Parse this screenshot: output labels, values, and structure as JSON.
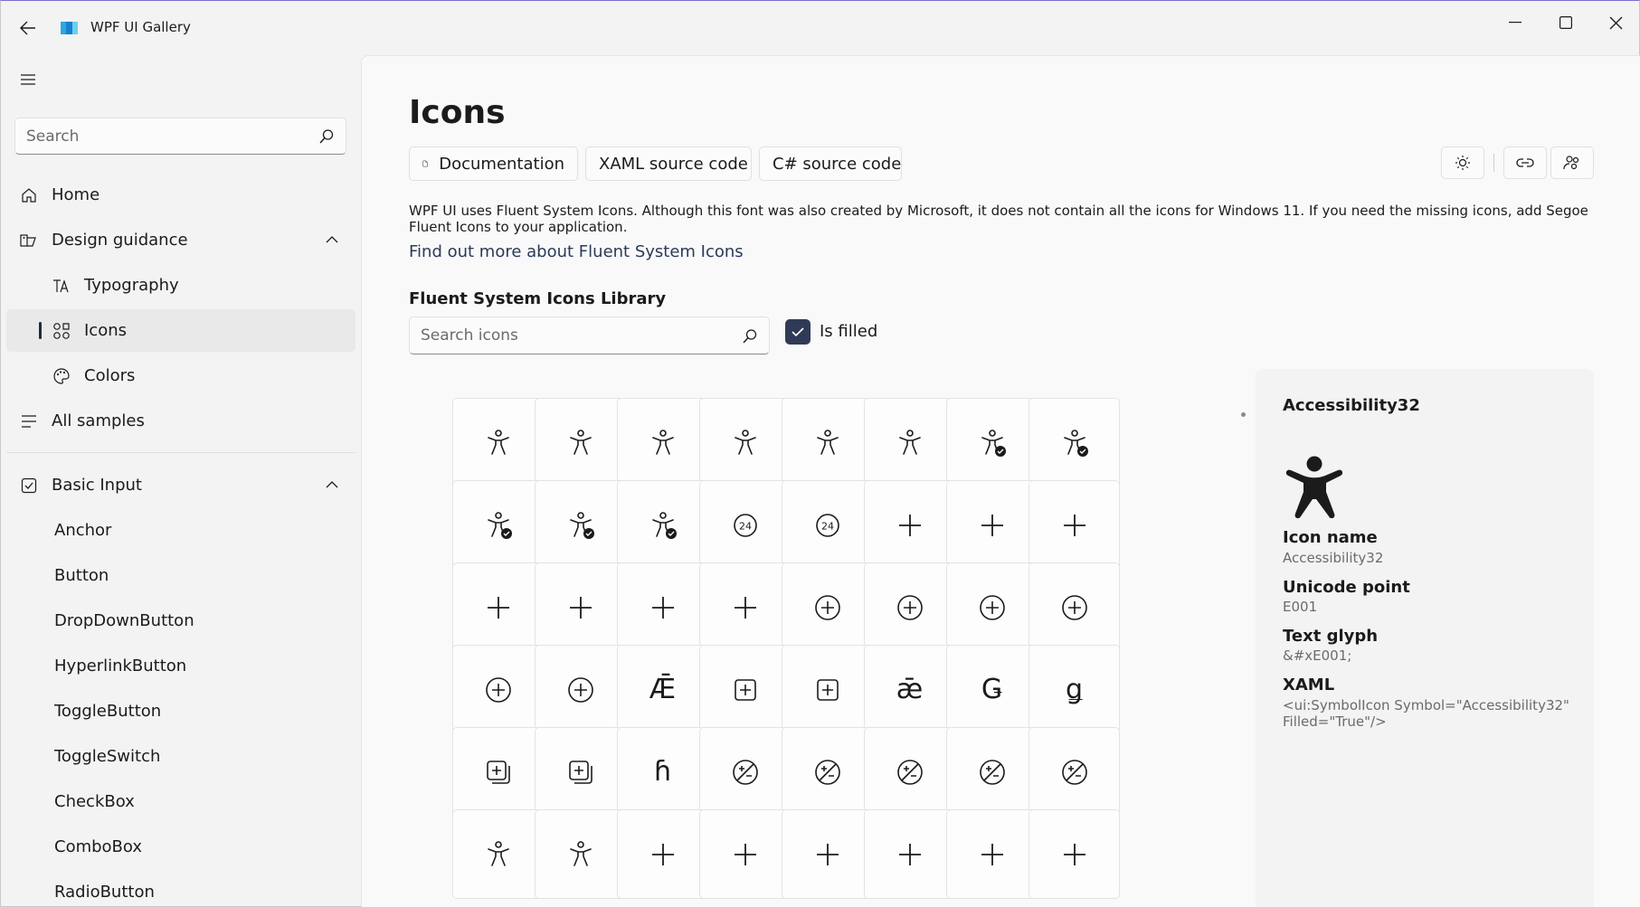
{
  "window": {
    "title": "WPF UI Gallery"
  },
  "sidebar": {
    "search_placeholder": "Search",
    "items": [
      {
        "label": "Home",
        "icon": "home-icon"
      },
      {
        "label": "Design guidance",
        "icon": "design-icon"
      },
      {
        "label": "Typography",
        "icon": "typography-icon"
      },
      {
        "label": "Icons",
        "icon": "icons-icon",
        "selected": true
      },
      {
        "label": "Colors",
        "icon": "palette-icon"
      },
      {
        "label": "All samples",
        "icon": "list-icon"
      },
      {
        "label": "Basic Input",
        "icon": "checkbox-icon"
      },
      {
        "label": "Anchor"
      },
      {
        "label": "Button"
      },
      {
        "label": "DropDownButton"
      },
      {
        "label": "HyperlinkButton"
      },
      {
        "label": "ToggleButton"
      },
      {
        "label": "ToggleSwitch"
      },
      {
        "label": "CheckBox"
      },
      {
        "label": "ComboBox"
      },
      {
        "label": "RadioButton"
      }
    ]
  },
  "page": {
    "title": "Icons",
    "buttons": {
      "documentation": "Documentation",
      "xaml_source": "XAML source code",
      "csharp_source": "C# source code"
    },
    "description": "WPF UI uses Fluent System Icons. Although this font was also created by Microsoft, it does not contain all the icons for Windows 11. If you need the missing icons, add Segoe Fluent Icons to your application.",
    "find_more": "Find out more about Fluent System Icons",
    "library_title": "Fluent System Icons Library",
    "icon_search_placeholder": "Search icons",
    "is_filled_label": "Is filled",
    "is_filled": true
  },
  "details": {
    "title": "Accessibility32",
    "icon_name_label": "Icon name",
    "icon_name": "Accessibility32",
    "unicode_label": "Unicode point",
    "unicode": "E001",
    "glyph_label": "Text glyph",
    "glyph": "&#xE001;",
    "xaml_label": "XAML",
    "xaml": "<ui:SymbolIcon Symbol=\"Accessibility32\" Filled=\"True\"/>"
  },
  "grid_icons": [
    [
      "accessibility-icon",
      "accessibility-icon",
      "accessibility-icon",
      "accessibility-icon",
      "accessibility-icon",
      "accessibility-icon",
      "accessibility-checkmark-icon",
      "accessibility-checkmark-icon"
    ],
    [
      "accessibility-checkmark-icon",
      "accessibility-checkmark-icon",
      "accessibility-checkmark-icon",
      "24-hour-icon",
      "24-hour-icon",
      "add-icon",
      "add-icon",
      "add-icon"
    ],
    [
      "add-icon",
      "add-icon",
      "add-icon",
      "add-icon",
      "add-circle-icon",
      "add-circle-icon",
      "add-circle-icon",
      "add-circle-icon"
    ],
    [
      "add-circle-icon",
      "add-circle-icon",
      "glyph:Ǣ",
      "add-square-icon",
      "add-square-icon",
      "glyph:ǣ",
      "glyph:Ǥ",
      "glyph:ǥ"
    ],
    [
      "add-square-multiple-icon",
      "add-square-multiple-icon",
      "glyph:ɦ",
      "add-subtract-circle-icon",
      "add-subtract-circle-icon",
      "add-subtract-circle-icon",
      "add-subtract-circle-icon",
      "add-subtract-circle-icon"
    ]
  ]
}
